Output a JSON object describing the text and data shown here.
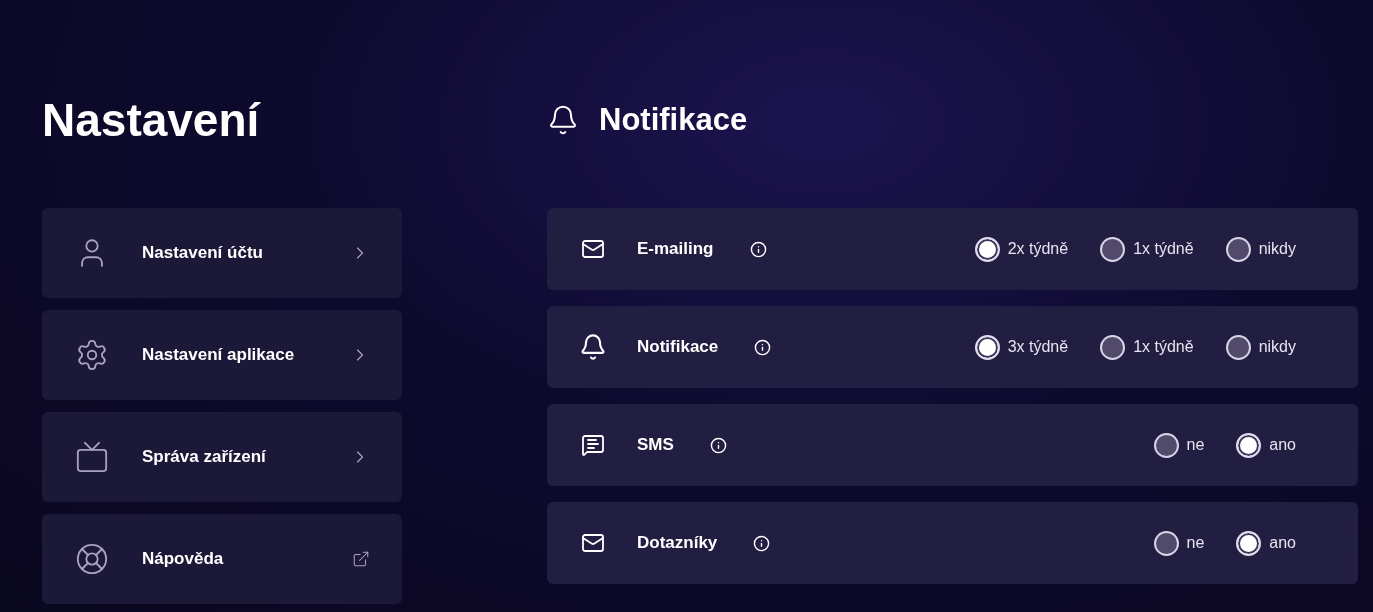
{
  "sidebar": {
    "title": "Nastavení",
    "items": [
      {
        "label": "Nastavení účtu",
        "kind": "user",
        "external": false
      },
      {
        "label": "Nastavení aplikace",
        "kind": "gear",
        "external": false
      },
      {
        "label": "Správa zařízení",
        "kind": "tv",
        "external": false
      },
      {
        "label": "Nápověda",
        "kind": "lifebuoy",
        "external": true
      }
    ]
  },
  "main": {
    "title": "Notifikace",
    "settings": [
      {
        "label": "E-mailing",
        "kind": "mail",
        "options": [
          {
            "label": "2x týdně",
            "selected": true
          },
          {
            "label": "1x týdně",
            "selected": false
          },
          {
            "label": "nikdy",
            "selected": false
          }
        ]
      },
      {
        "label": "Notifikace",
        "kind": "bell",
        "options": [
          {
            "label": "3x týdně",
            "selected": true
          },
          {
            "label": "1x týdně",
            "selected": false
          },
          {
            "label": "nikdy",
            "selected": false
          }
        ]
      },
      {
        "label": "SMS",
        "kind": "message",
        "options": [
          {
            "label": "ne",
            "selected": false
          },
          {
            "label": "ano",
            "selected": true
          }
        ]
      },
      {
        "label": "Dotazníky",
        "kind": "mail",
        "options": [
          {
            "label": "ne",
            "selected": false
          },
          {
            "label": "ano",
            "selected": true
          }
        ]
      }
    ]
  }
}
